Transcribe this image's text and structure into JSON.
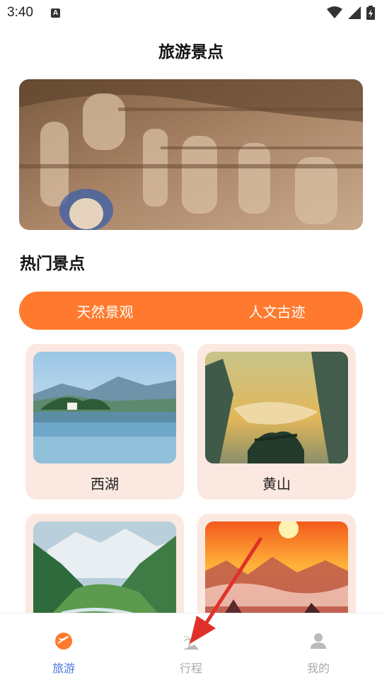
{
  "status_bar": {
    "time": "3:40",
    "notification_icon": "A"
  },
  "header": {
    "title": "旅游景点"
  },
  "banner": {
    "image": "grotto-carvings-photo"
  },
  "section": {
    "title": "热门景点"
  },
  "tabs": [
    {
      "label": "天然景观"
    },
    {
      "label": "人文古迹"
    }
  ],
  "spots": [
    {
      "name": "西湖",
      "image": "west-lake-photo"
    },
    {
      "name": "黄山",
      "image": "huangshan-photo"
    },
    {
      "name": "",
      "image": "mountain-valley-photo"
    },
    {
      "name": "",
      "image": "sunset-mountains-photo"
    }
  ],
  "bottom_nav": [
    {
      "label": "旅游",
      "icon": "travel-icon",
      "active": true
    },
    {
      "label": "行程",
      "icon": "palm-tree-icon",
      "active": false
    },
    {
      "label": "我的",
      "icon": "user-icon",
      "active": false
    }
  ],
  "colors": {
    "accent": "#ff7a2e",
    "active_nav": "#4a78e0",
    "card_bg": "#fbe8e0",
    "annotation_arrow": "#e0302a"
  }
}
